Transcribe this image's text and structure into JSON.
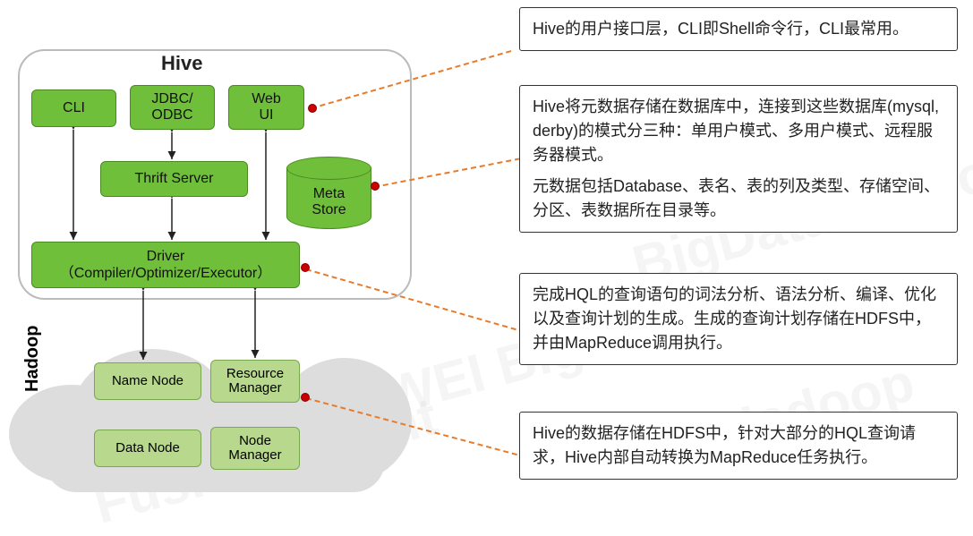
{
  "hive": {
    "title": "Hive",
    "cli": "CLI",
    "jdbc": "JDBC/\nODBC",
    "webui": "Web\nUI",
    "thrift": "Thrift Server",
    "driver": "Driver\n（Compiler/Optimizer/Executor）",
    "metastore": "Meta\nStore"
  },
  "hadoop": {
    "label": "Hadoop",
    "nn": "Name Node",
    "rm": "Resource\nManager",
    "dn": "Data Node",
    "nm": "Node\nManager"
  },
  "callouts": {
    "c1": "Hive的用户接口层，CLI即Shell命令行，CLI最常用。",
    "c2a": "Hive将元数据存储在数据库中，连接到这些数据库(mysql, derby)的模式分三种：单用户模式、多用户模式、远程服务器模式。",
    "c2b": "元数据包括Database、表名、表的列及类型、存储空间、分区、表数据所在目录等。",
    "c3": "完成HQL的查询语句的词法分析、语法分析、编译、优化以及查询计划的生成。生成的查询计划存储在HDFS中，并由MapReduce调用执行。",
    "c4": "Hive的数据存储在HDFS中，针对大部分的HQL查询请求，Hive内部自动转换为MapReduce任务执行。"
  },
  "watermarks": {
    "w1": "HUAWEI BigData",
    "w2": "BigData Platform",
    "w3": "FusionInsight",
    "w4": "Hadoop"
  }
}
